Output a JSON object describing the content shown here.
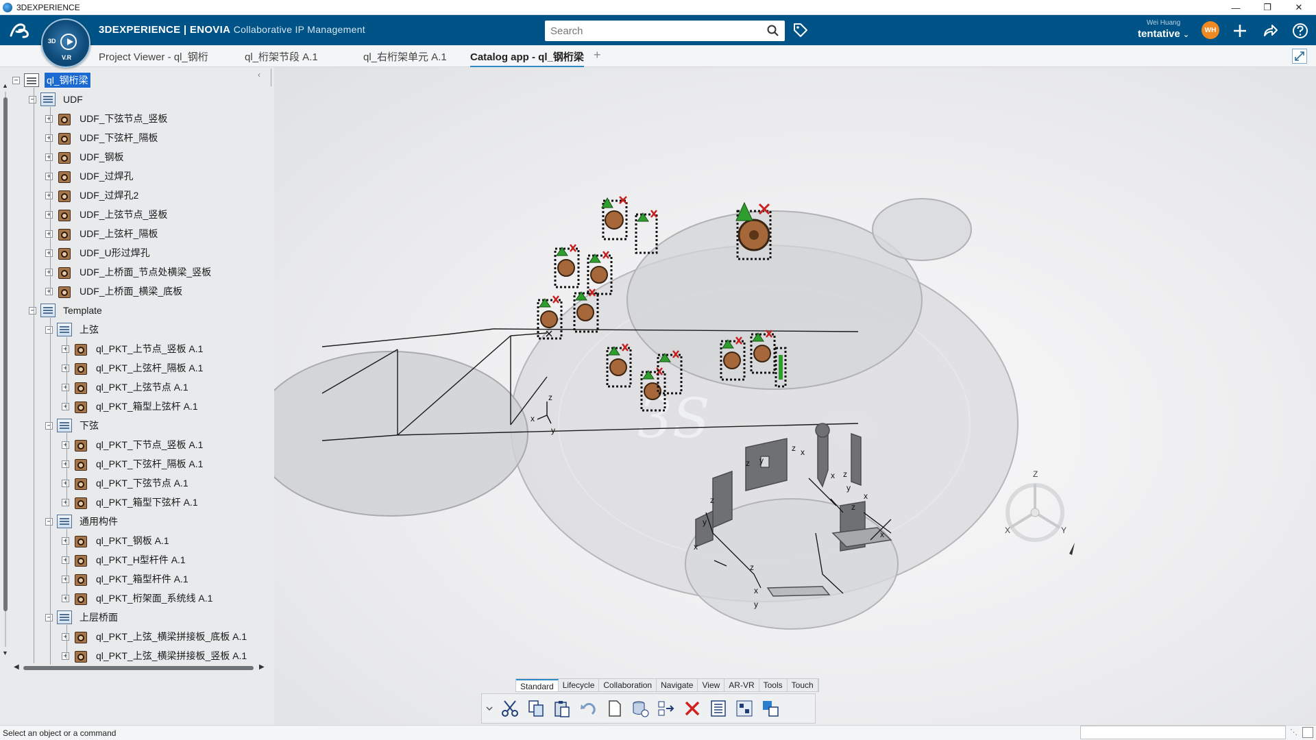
{
  "window": {
    "title": "3DEXPERIENCE",
    "controls": [
      "minimize-icon",
      "restore-icon",
      "close-icon"
    ]
  },
  "appbar": {
    "brand_main": "3DEXPERIENCE | ENOVIA",
    "brand_sub": "Collaborative IP Management",
    "search_placeholder": "Search",
    "user_name": "Wei Huang",
    "user_role": "tentative",
    "avatar_initials": "WH",
    "colors": {
      "header": "#005386",
      "accent": "#2f89c7",
      "avatar": "#ef8a23"
    }
  },
  "compass": {
    "label_3d": "3D",
    "label_vr": "V.R"
  },
  "tabs": [
    {
      "label": "Project Viewer - ql_钢桁",
      "active": false
    },
    {
      "label": "ql_桁架节段 A.1",
      "active": false
    },
    {
      "label": "ql_右桁架单元 A.1",
      "active": false
    },
    {
      "label": "Catalog app - ql_钢桁梁",
      "active": true
    }
  ],
  "tab_add": "+",
  "tree": {
    "root": "ql_钢桁梁",
    "udf_folder": "UDF",
    "udf_items": [
      "UDF_下弦节点_竖板",
      "UDF_下弦杆_隔板",
      "UDF_钢板",
      "UDF_过焊孔",
      "UDF_过焊孔2",
      "UDF_上弦节点_竖板",
      "UDF_上弦杆_隔板",
      "UDF_U形过焊孔",
      "UDF_上桥面_节点处横梁_竖板",
      "UDF_上桥面_横梁_底板"
    ],
    "template_folder": "Template",
    "groups": [
      {
        "name": "上弦",
        "items": [
          "ql_PKT_上节点_竖板 A.1",
          "ql_PKT_上弦杆_隔板 A.1",
          "ql_PKT_上弦节点 A.1",
          "ql_PKT_箱型上弦杆 A.1"
        ]
      },
      {
        "name": "下弦",
        "items": [
          "ql_PKT_下节点_竖板 A.1",
          "ql_PKT_下弦杆_隔板 A.1",
          "ql_PKT_下弦节点 A.1",
          "ql_PKT_箱型下弦杆 A.1"
        ]
      },
      {
        "name": "通用构件",
        "items": [
          "ql_PKT_钢板 A.1",
          "ql_PKT_H型杆件 A.1",
          "ql_PKT_箱型杆件 A.1",
          "ql_PKT_桁架面_系统线 A.1"
        ]
      },
      {
        "name": "上层桥面",
        "items": [
          "ql_PKT_上弦_横梁拼接板_底板 A.1",
          "ql_PKT_上弦_横梁拼接板_竖板 A.1"
        ]
      }
    ]
  },
  "viewport": {
    "axis_labels": {
      "x": "x",
      "y": "y",
      "z": "z"
    },
    "compass_axes": {
      "x": "X",
      "y": "Y",
      "z": "Z"
    }
  },
  "action_tabs": [
    "Standard",
    "Lifecycle",
    "Collaboration",
    "Navigate",
    "View",
    "AR-VR",
    "Tools",
    "Touch"
  ],
  "action_tab_active": "Standard",
  "action_buttons": [
    "dropdown-icon",
    "cut-icon",
    "copy-icon",
    "paste-icon",
    "undo-icon",
    "new-icon",
    "save-to-database-icon",
    "replace-icon",
    "delete-icon",
    "properties-icon",
    "tree-layout-icon",
    "swap-visible-space-icon"
  ],
  "status": {
    "message": "Select an object or a command"
  }
}
